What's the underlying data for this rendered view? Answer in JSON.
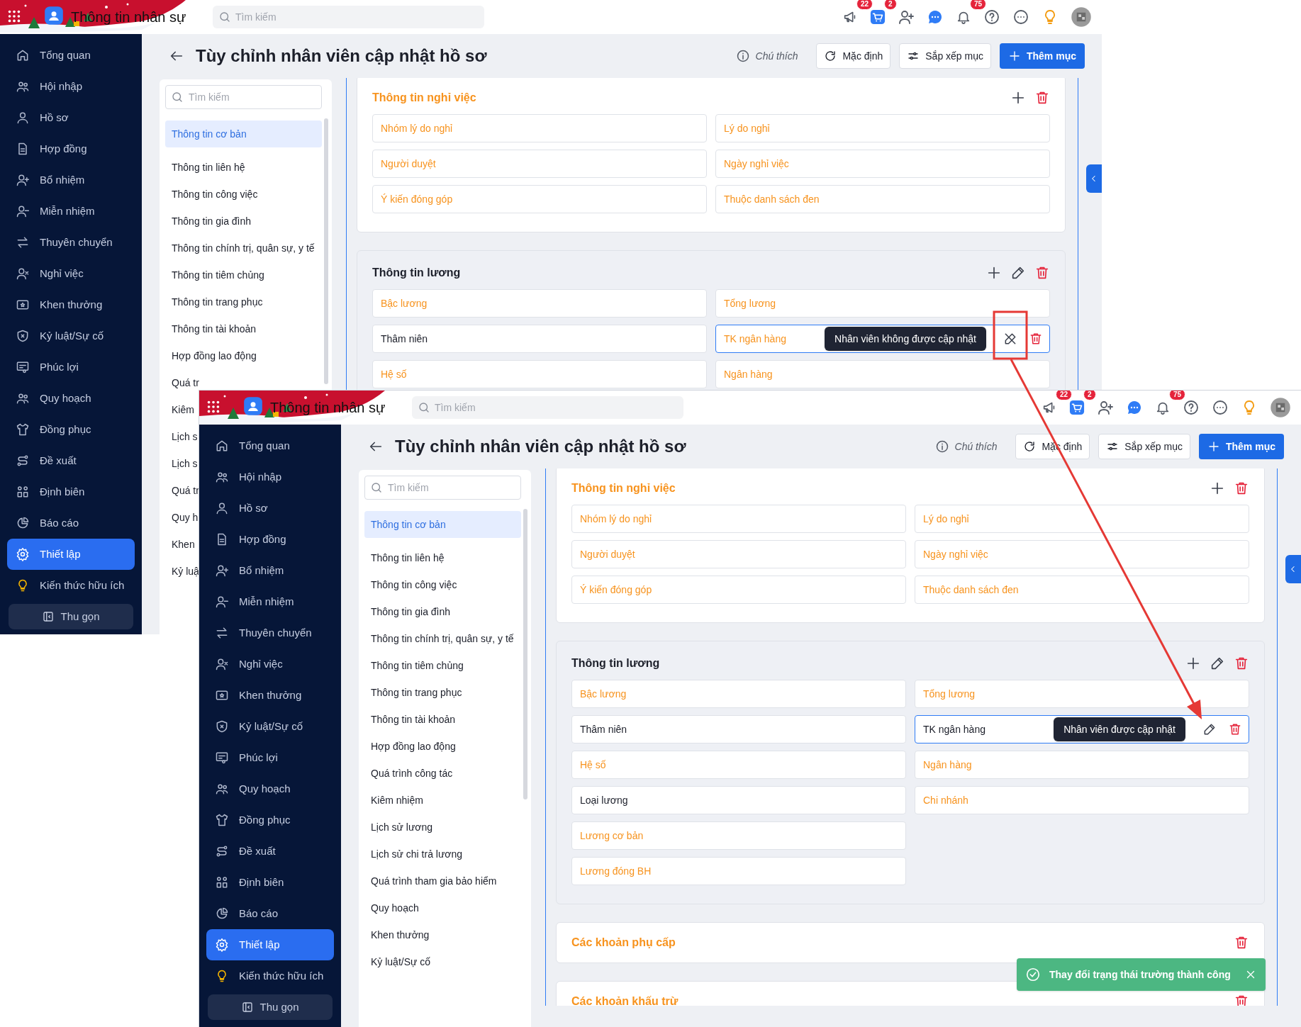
{
  "windows": [
    {
      "app_title": "Thông tin nhân sự",
      "search_placeholder": "Tìm kiếm",
      "badges": {
        "megaphone": "22",
        "cart": "2",
        "bell": "75"
      },
      "sidebar": {
        "items": [
          {
            "label": "Tổng quan",
            "selected": false
          },
          {
            "label": "Hội nhập",
            "selected": false
          },
          {
            "label": "Hồ sơ",
            "selected": false
          },
          {
            "label": "Hợp đồng",
            "selected": false
          },
          {
            "label": "Bổ nhiệm",
            "selected": false
          },
          {
            "label": "Miễn nhiệm",
            "selected": false
          },
          {
            "label": "Thuyên chuyển",
            "selected": false
          },
          {
            "label": "Nghỉ việc",
            "selected": false
          },
          {
            "label": "Khen thưởng",
            "selected": false
          },
          {
            "label": "Kỷ luật/Sự cố",
            "selected": false
          },
          {
            "label": "Phúc lợi",
            "selected": false
          },
          {
            "label": "Quy hoạch",
            "selected": false
          },
          {
            "label": "Đồng phục",
            "selected": false
          },
          {
            "label": "Đề xuất",
            "selected": false
          },
          {
            "label": "Định biên",
            "selected": false
          },
          {
            "label": "Báo cáo",
            "selected": false
          },
          {
            "label": "Thiết lập",
            "selected": true
          },
          {
            "label": "Kiến thức hữu ích",
            "selected": false
          }
        ],
        "collapse_button": "Thu gọn"
      },
      "page_title": "Tùy chỉnh nhân viên cập nhật hồ sơ",
      "toolbar": [
        {
          "kind": "legend",
          "label": "Chú thích"
        },
        {
          "kind": "reset",
          "label": "Mặc định"
        },
        {
          "kind": "sort",
          "label": "Sắp xếp mục"
        },
        {
          "kind": "add",
          "label": "Thêm mục"
        }
      ],
      "section_list": {
        "search_placeholder": "Tìm kiếm",
        "items": [
          {
            "label": "Thông tin cơ bản",
            "selected": true
          },
          {
            "label": "Thông tin liên hệ",
            "selected": false
          },
          {
            "label": "Thông tin công việc",
            "selected": false
          },
          {
            "label": "Thông tin gia đình",
            "selected": false
          },
          {
            "label": "Thông tin chính trị, quân sự, y tế",
            "selected": false
          },
          {
            "label": "Thông tin tiêm chủng",
            "selected": false
          },
          {
            "label": "Thông tin trang phục",
            "selected": false
          },
          {
            "label": "Thông tin tài khoản",
            "selected": false
          },
          {
            "label": "Hợp đồng lao động",
            "selected": false
          },
          {
            "label": "Quá tr",
            "selected": false
          },
          {
            "label": "Kiêm",
            "selected": false
          },
          {
            "label": "Lịch s",
            "selected": false
          },
          {
            "label": "Lịch s",
            "selected": false
          },
          {
            "label": "Quá tr",
            "selected": false
          },
          {
            "label": "Quy h",
            "selected": false
          },
          {
            "label": "Khen",
            "selected": false
          },
          {
            "label": "Kỷ luậ",
            "selected": false
          }
        ]
      },
      "sections": [
        {
          "title": "Thông tin nghỉ việc",
          "editable": false,
          "highlighted": false,
          "actions": [
            {
              "kind": "add"
            },
            {
              "kind": "delete"
            }
          ],
          "columns": [
            [
              {
                "label": "Nhóm lý do nghỉ",
                "editable": false
              },
              {
                "label": "Người duyệt",
                "editable": false
              },
              {
                "label": "Ý kiến đóng góp",
                "editable": false
              }
            ],
            [
              {
                "label": "Lý do nghỉ",
                "editable": false
              },
              {
                "label": "Ngày nghỉ việc",
                "editable": false
              },
              {
                "label": "Thuộc danh sách đen",
                "editable": false
              }
            ]
          ]
        },
        {
          "title": "Thông tin lương",
          "editable": true,
          "highlighted": true,
          "actions": [
            {
              "kind": "add"
            },
            {
              "kind": "edit"
            },
            {
              "kind": "delete"
            }
          ],
          "columns": [
            [
              {
                "label": "Bậc lương",
                "editable": false
              },
              {
                "label": "Thâm niên",
                "editable": true
              },
              {
                "label": "Hệ số",
                "editable": false
              }
            ],
            [
              {
                "label": "Tổng lương",
                "editable": false
              },
              {
                "label": "TK ngân hàng",
                "editable": false,
                "hovered": true,
                "tooltip": "Nhân viên không được cập nhật"
              },
              {
                "label": "Ngân hàng",
                "editable": false
              }
            ]
          ]
        }
      ]
    },
    {
      "app_title": "Thông tin nhân sự",
      "search_placeholder": "Tìm kiếm",
      "badges": {
        "megaphone": "22",
        "cart": "2",
        "bell": "75"
      },
      "sidebar": {
        "items": [
          {
            "label": "Tổng quan",
            "selected": false
          },
          {
            "label": "Hội nhập",
            "selected": false
          },
          {
            "label": "Hồ sơ",
            "selected": false
          },
          {
            "label": "Hợp đồng",
            "selected": false
          },
          {
            "label": "Bổ nhiệm",
            "selected": false
          },
          {
            "label": "Miễn nhiệm",
            "selected": false
          },
          {
            "label": "Thuyên chuyển",
            "selected": false
          },
          {
            "label": "Nghỉ việc",
            "selected": false
          },
          {
            "label": "Khen thưởng",
            "selected": false
          },
          {
            "label": "Kỷ luật/Sự cố",
            "selected": false
          },
          {
            "label": "Phúc lợi",
            "selected": false
          },
          {
            "label": "Quy hoạch",
            "selected": false
          },
          {
            "label": "Đồng phục",
            "selected": false
          },
          {
            "label": "Đề xuất",
            "selected": false
          },
          {
            "label": "Định biên",
            "selected": false
          },
          {
            "label": "Báo cáo",
            "selected": false
          },
          {
            "label": "Thiết lập",
            "selected": true
          },
          {
            "label": "Kiến thức hữu ích",
            "selected": false
          }
        ],
        "collapse_button": "Thu gọn"
      },
      "page_title": "Tùy chỉnh nhân viên cập nhật hồ sơ",
      "toolbar": [
        {
          "kind": "legend",
          "label": "Chú thích"
        },
        {
          "kind": "reset",
          "label": "Mặc định"
        },
        {
          "kind": "sort",
          "label": "Sắp xếp mục"
        },
        {
          "kind": "add",
          "label": "Thêm mục"
        }
      ],
      "section_list": {
        "search_placeholder": "Tìm kiếm",
        "items": [
          {
            "label": "Thông tin cơ bản",
            "selected": true
          },
          {
            "label": "Thông tin liên hệ",
            "selected": false
          },
          {
            "label": "Thông tin công việc",
            "selected": false
          },
          {
            "label": "Thông tin gia đình",
            "selected": false
          },
          {
            "label": "Thông tin chính trị, quân sự, y tế",
            "selected": false
          },
          {
            "label": "Thông tin tiêm chủng",
            "selected": false
          },
          {
            "label": "Thông tin trang phục",
            "selected": false
          },
          {
            "label": "Thông tin tài khoản",
            "selected": false
          },
          {
            "label": "Hợp đồng lao động",
            "selected": false
          },
          {
            "label": "Quá trình công tác",
            "selected": false
          },
          {
            "label": "Kiêm nhiệm",
            "selected": false
          },
          {
            "label": "Lịch sử lương",
            "selected": false
          },
          {
            "label": "Lịch sử chi trả lương",
            "selected": false
          },
          {
            "label": "Quá trình tham gia bảo hiểm",
            "selected": false
          },
          {
            "label": "Quy hoạch",
            "selected": false
          },
          {
            "label": "Khen thưởng",
            "selected": false
          },
          {
            "label": "Kỷ luật/Sự cố",
            "selected": false
          }
        ]
      },
      "sections": [
        {
          "title": "Thông tin nghỉ việc",
          "editable": false,
          "highlighted": false,
          "actions": [
            {
              "kind": "add"
            },
            {
              "kind": "delete"
            }
          ],
          "columns": [
            [
              {
                "label": "Nhóm lý do nghỉ",
                "editable": false
              },
              {
                "label": "Người duyệt",
                "editable": false
              },
              {
                "label": "Ý kiến đóng góp",
                "editable": false
              }
            ],
            [
              {
                "label": "Lý do nghỉ",
                "editable": false
              },
              {
                "label": "Ngày nghỉ việc",
                "editable": false
              },
              {
                "label": "Thuộc danh sách đen",
                "editable": false
              }
            ]
          ]
        },
        {
          "title": "Thông tin lương",
          "editable": true,
          "highlighted": true,
          "actions": [
            {
              "kind": "add"
            },
            {
              "kind": "edit"
            },
            {
              "kind": "delete"
            }
          ],
          "columns": [
            [
              {
                "label": "Bậc lương",
                "editable": false
              },
              {
                "label": "Thâm niên",
                "editable": true
              },
              {
                "label": "Hệ số",
                "editable": false
              },
              {
                "label": "Loại lương",
                "editable": true
              },
              {
                "label": "Lương cơ bản",
                "editable": false
              },
              {
                "label": "Lương đóng BH",
                "editable": false
              }
            ],
            [
              {
                "label": "Tổng lương",
                "editable": false
              },
              {
                "label": "TK ngân hàng",
                "editable": true,
                "hovered": true,
                "tooltip": "Nhân viên được cập nhật"
              },
              {
                "label": "Ngân hàng",
                "editable": false
              },
              {
                "label": "Chi nhánh",
                "editable": false
              }
            ]
          ]
        },
        {
          "title": "Các khoản phụ cấp",
          "editable": false,
          "highlighted": false,
          "actions": [
            {
              "kind": "delete"
            }
          ]
        },
        {
          "title": "Các khoản khấu trừ",
          "editable": false,
          "highlighted": false,
          "actions": [
            {
              "kind": "delete"
            }
          ]
        }
      ],
      "toast": {
        "message": "Thay đổi trạng thái trường thành công"
      }
    }
  ]
}
